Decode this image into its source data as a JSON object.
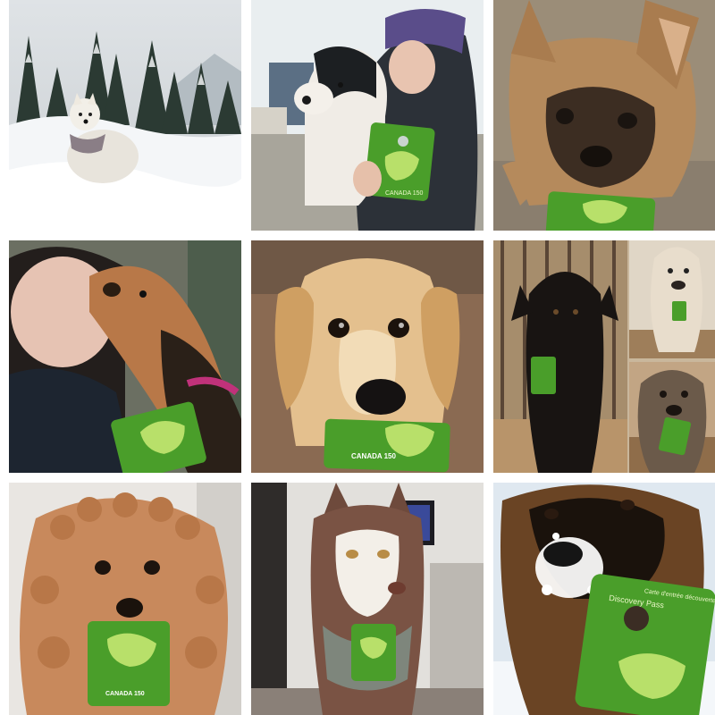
{
  "gallery": {
    "tiles": [
      {
        "subject": "white westie dog in snowy mountain forest"
      },
      {
        "subject": "woman kissing black and white dog holding green pass"
      },
      {
        "subject": "brown french bulldog lying with green pass"
      },
      {
        "subject": "woman hugging shaggy dog with pink collar and green pass"
      },
      {
        "subject": "golden retriever puppy holding green pass in mouth"
      },
      {
        "subject": "collage of three dogs on wooden deck with green passes"
      },
      {
        "subject": "apricot poodle holding green pass"
      },
      {
        "subject": "husky with bandana and green pass"
      },
      {
        "subject": "german shepherd with snowy nose holding green pass"
      }
    ],
    "card": {
      "canada_150": "CANADA 150",
      "pass_name_en": "Discovery Pass",
      "pass_name_fr": "Carte d'entrée découverte"
    },
    "colors": {
      "card_green": "#4a9e2a",
      "card_dark": "#2f7a1b",
      "card_light": "#b8e06a"
    }
  }
}
